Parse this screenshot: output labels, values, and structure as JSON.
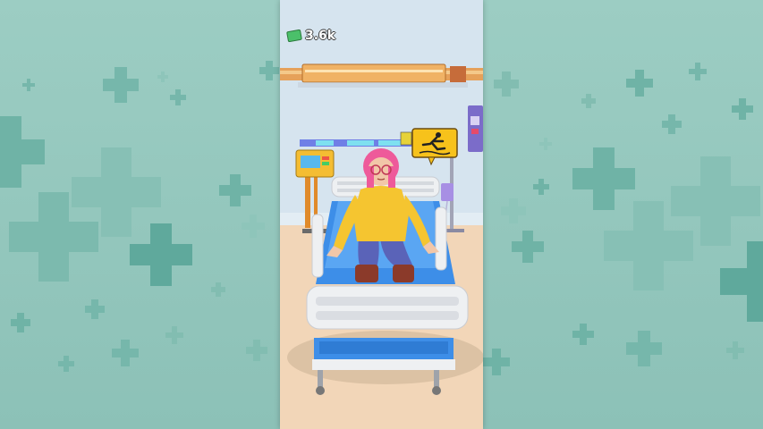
{
  "hud": {
    "currency_amount": "3.6k",
    "currency_icon": "cash-icon"
  },
  "scene": {
    "patient": "patient-character",
    "bed": "hospital-bed",
    "monitor": "medical-monitor",
    "iv_stand": "iv-stand",
    "warning_sign": "slip-warning-sign"
  },
  "colors": {
    "background": "#8fc3b9",
    "cross": "#5fa99c",
    "wall": "#d6e4ef",
    "floor": "#f2d6b8",
    "bed_blue": "#3d8ee8",
    "bed_frame": "#eef0f2",
    "patient_hair": "#ee5a9a",
    "patient_shirt": "#f5c530",
    "patient_pants": "#5a63b8",
    "sign_yellow": "#f7c21b"
  }
}
